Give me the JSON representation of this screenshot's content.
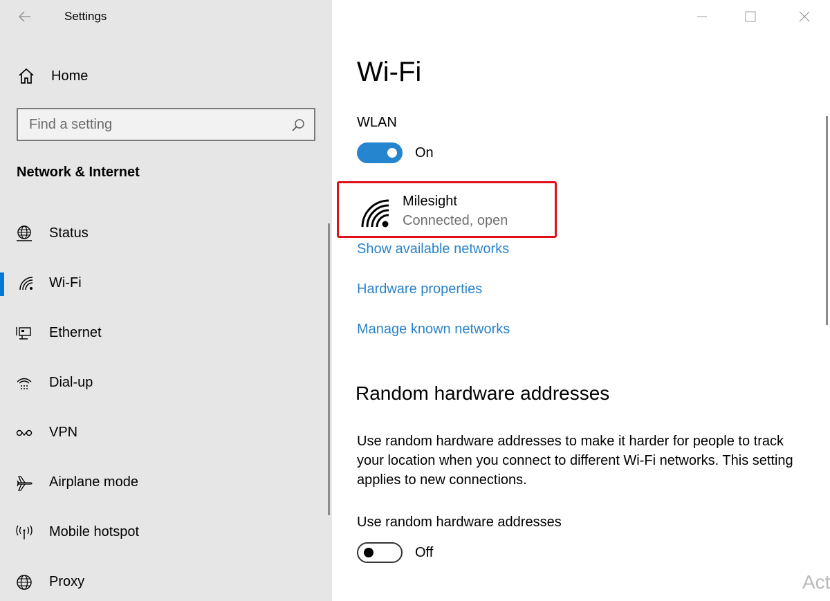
{
  "app": {
    "title": "Settings"
  },
  "sidebar": {
    "home_label": "Home",
    "search_placeholder": "Find a setting",
    "section_title": "Network & Internet",
    "items": [
      {
        "label": "Status",
        "icon": "globe-status-icon"
      },
      {
        "label": "Wi-Fi",
        "icon": "wifi-icon",
        "selected": true
      },
      {
        "label": "Ethernet",
        "icon": "ethernet-icon"
      },
      {
        "label": "Dial-up",
        "icon": "dialup-icon"
      },
      {
        "label": "VPN",
        "icon": "vpn-icon"
      },
      {
        "label": "Airplane mode",
        "icon": "airplane-icon"
      },
      {
        "label": "Mobile hotspot",
        "icon": "hotspot-icon"
      },
      {
        "label": "Proxy",
        "icon": "globe-icon"
      }
    ]
  },
  "main": {
    "title": "Wi-Fi",
    "wlan": {
      "label": "WLAN",
      "state": "On"
    },
    "network": {
      "name": "Milesight",
      "status": "Connected, open"
    },
    "links": [
      "Show available networks",
      "Hardware properties",
      "Manage known networks"
    ],
    "random_section": {
      "heading": "Random hardware addresses",
      "description": "Use random hardware addresses to make it harder for people to track your location when you connect to different Wi-Fi networks. This setting applies to new connections.",
      "toggle_label": "Use random hardware addresses",
      "state": "Off"
    },
    "watermark": "Act"
  },
  "colors": {
    "accent": "#0078d7",
    "link": "#2a83c9",
    "toggle_on": "#2585cf",
    "highlight_box": "#e0101b",
    "sidebar_bg": "#e6e6e6"
  }
}
